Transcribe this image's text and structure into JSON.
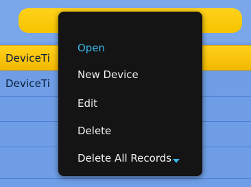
{
  "list": {
    "rows": [
      {
        "label": "DeviceTi"
      },
      {
        "label": "DeviceTi"
      }
    ]
  },
  "menu": {
    "items": [
      {
        "label": "Open"
      },
      {
        "label": "New Device"
      },
      {
        "label": "Edit"
      },
      {
        "label": "Delete"
      },
      {
        "label": "Delete All Records"
      }
    ]
  },
  "colors": {
    "background": "#6f9ee6",
    "selection": "#f5c400",
    "menu_bg": "#141414",
    "menu_text": "#f2f2f2",
    "menu_active": "#35b7e6"
  },
  "icons": {
    "menu_scroll_more": "triangle-down-icon"
  }
}
